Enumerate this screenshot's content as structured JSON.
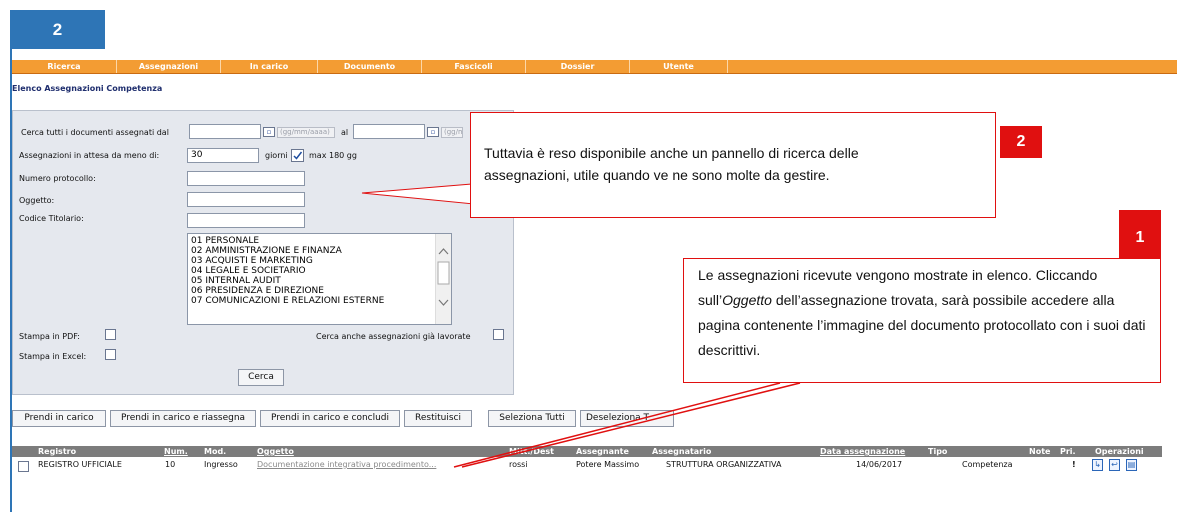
{
  "step_badge": "2",
  "nav": [
    "Ricerca",
    "Assegnazioni",
    "In carico",
    "Documento",
    "Fascicoli",
    "Dossier",
    "Utente"
  ],
  "page_title": "Elenco Assegnazioni Competenza",
  "search": {
    "date_from_label": "Cerca tutti i documenti assegnati dal",
    "date_from_value": "",
    "date_format_hint": "(gg/mm/aaaa)",
    "date_to_label": "al",
    "date_to_value": "",
    "date_to_hint": "(gg/m",
    "pending_label": "Assegnazioni in attesa da meno di:",
    "pending_value": "30",
    "pending_unit": "giorni",
    "pending_max": "max 180 gg",
    "protocol_label": "Numero protocollo:",
    "protocol_value": "",
    "subject_label": "Oggetto:",
    "subject_value": "",
    "titolario_label": "Codice Titolario:",
    "titolario_value": "",
    "titolario_options": [
      "01 PERSONALE",
      "02 AMMINISTRAZIONE E FINANZA",
      "03 ACQUISTI E MARKETING",
      "04 LEGALE E SOCIETARIO",
      "05 INTERNAL AUDIT",
      "06 PRESIDENZA E DIREZIONE",
      "07 COMUNICAZIONI E RELAZIONI ESTERNE"
    ],
    "pdf_label": "Stampa in PDF:",
    "excel_label": "Stampa in Excel:",
    "worked_label": "Cerca anche assegnazioni già lavorate",
    "search_button": "Cerca"
  },
  "actions": [
    "Prendi in carico",
    "Prendi in carico e riassegna",
    "Prendi in carico e concludi",
    "Restituisci",
    "Seleziona Tutti",
    "Deseleziona T"
  ],
  "table": {
    "headers": [
      "Registro",
      "Num.",
      "Mod.",
      "Oggetto",
      "Mitt./Dest",
      "Assegnante",
      "Assegnatario",
      "Data assegnazione",
      "Tipo",
      "Note",
      "Pri.",
      "Operazioni"
    ],
    "rows": [
      {
        "registro": "REGISTRO UFFICIALE",
        "num": "10",
        "mod": "Ingresso",
        "oggetto": "Documentazione integrativa procedimento...",
        "mitt_dest": "rossi",
        "assegnante": "Potere Massimo",
        "assegnatario": "STRUTTURA ORGANIZZATIVA",
        "data": "14/06/2017",
        "tipo": "Competenza",
        "note": "",
        "pri": "!"
      }
    ]
  },
  "callouts": {
    "two": {
      "number": "2",
      "text": "Tuttavia è reso disponibile anche un pannello di ricerca delle assegnazioni, utile quando ve ne sono molte da gestire."
    },
    "one": {
      "number": "1",
      "text_before": "Le assegnazioni ricevute vengono mostrate in elenco. Cliccando sull’",
      "text_em": "Oggetto",
      "text_after": " dell’assegnazione trovata, sarà possibile accedere alla pagina contenente l’immagine del documento protocollato con i suoi dati descrittivi."
    }
  },
  "colors": {
    "accent_blue": "#2e75b6",
    "nav_orange": "#f39c33",
    "callout_red": "#e01010",
    "table_header": "#7c7c7c"
  }
}
